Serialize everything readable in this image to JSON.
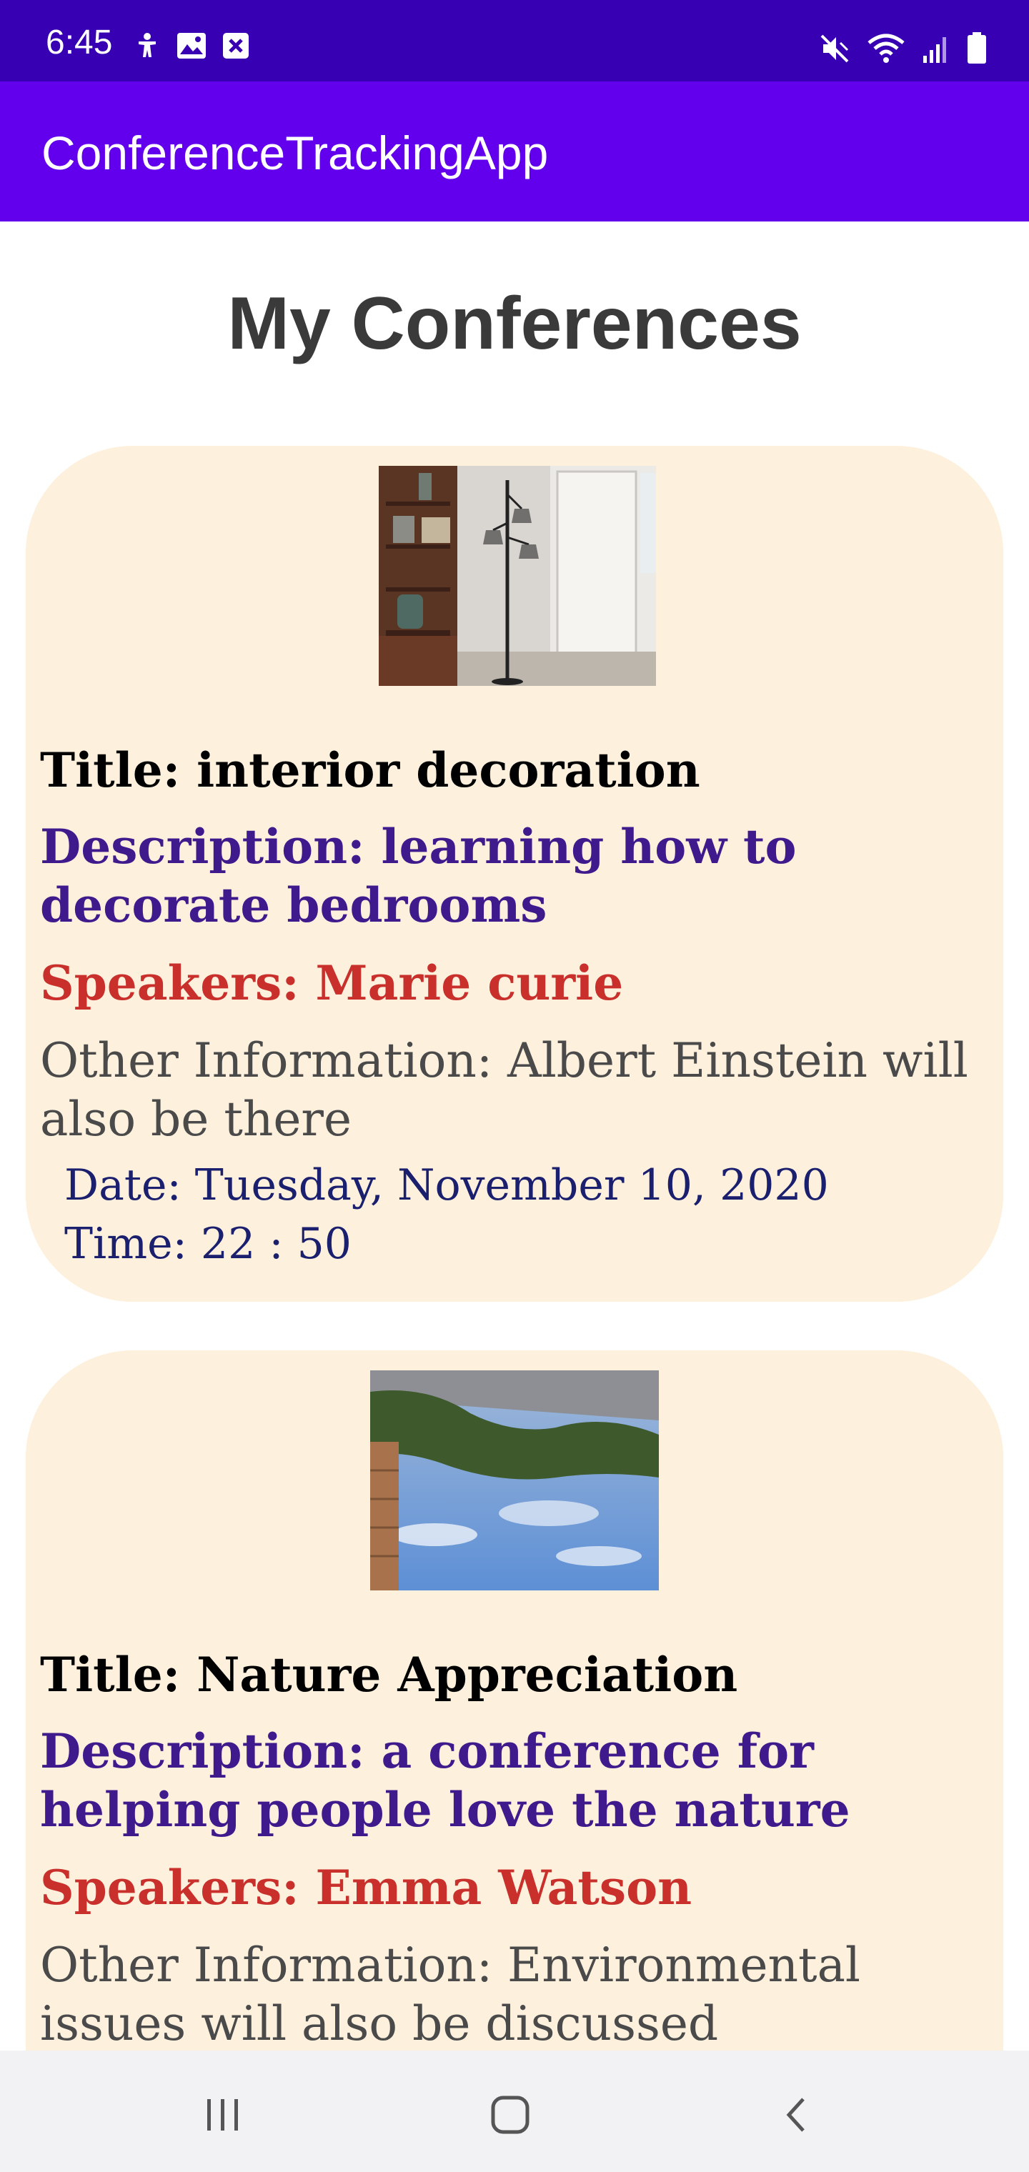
{
  "status_bar": {
    "time": "6:45",
    "left_icons": [
      "accessibility-icon",
      "image-icon",
      "close-box-icon"
    ],
    "right_icons": [
      "mute-icon",
      "wifi-icon",
      "signal-icon",
      "battery-icon"
    ]
  },
  "app_bar": {
    "title": "ConferenceTrackingApp"
  },
  "page_title": "My Conferences",
  "conferences": [
    {
      "image": "interior-room-photo",
      "title": "Title: interior decoration",
      "description": "Description: learning how to decorate bedrooms",
      "speakers": "Speakers: Marie curie",
      "other_info": "Other Information: Albert Einstein will also be there",
      "date": "Date: Tuesday, November 10, 2020",
      "time": "Time: 22 : 50"
    },
    {
      "image": "nature-reflection-photo",
      "title": "Title: Nature Appreciation",
      "description": "Description: a conference for helping people love the nature",
      "speakers": "Speakers: Emma Watson",
      "other_info": "Other Information: Environmental issues will also be discussed"
    }
  ],
  "nav_bar": {
    "icons": [
      "recent-apps-icon",
      "home-icon",
      "back-icon"
    ]
  },
  "colors": {
    "status_bar": "#3700b3",
    "app_bar": "#6200ee",
    "card_bg": "#fdf0dd",
    "description": "#3f1a8c",
    "speakers": "#c9302c",
    "date_time": "#1a1f6e"
  }
}
